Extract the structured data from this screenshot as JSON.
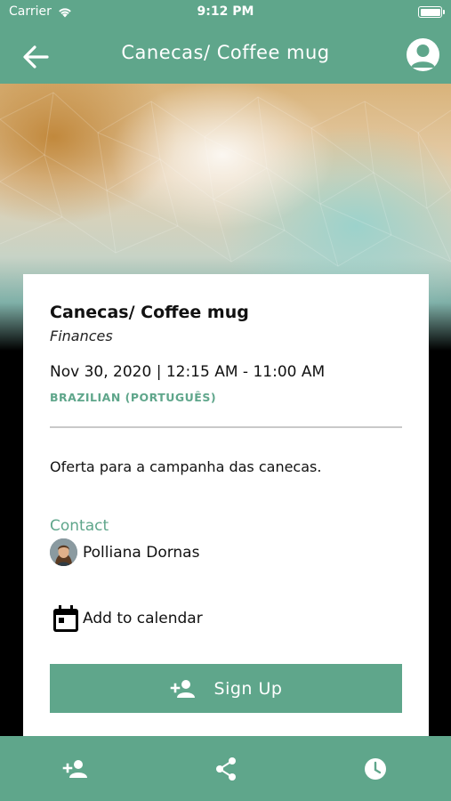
{
  "status_bar": {
    "carrier": "Carrier",
    "time": "9:12 PM"
  },
  "nav": {
    "title": "Canecas/ Coffee mug",
    "back_icon": "arrow-left-icon",
    "profile_icon": "account-circle-icon"
  },
  "event": {
    "title": "Canecas/ Coffee mug",
    "category": "Finances",
    "datetime": "Nov 30, 2020 | 12:15 AM - 11:00 AM",
    "language": "BRAZILIAN (PORTUGUÊS)",
    "description": "Oferta para a campanha das canecas.",
    "contact_label": "Contact",
    "contact_name": "Polliana Dornas",
    "calendar_label": "Add to calendar",
    "signup_label": "Sign Up"
  },
  "tab_bar": {
    "items": [
      "person-add-icon",
      "share-icon",
      "clock-icon"
    ]
  },
  "colors": {
    "accent": "#5fa68b",
    "card": "#ffffff",
    "text": "#111111",
    "divider": "#c9c9c9"
  }
}
